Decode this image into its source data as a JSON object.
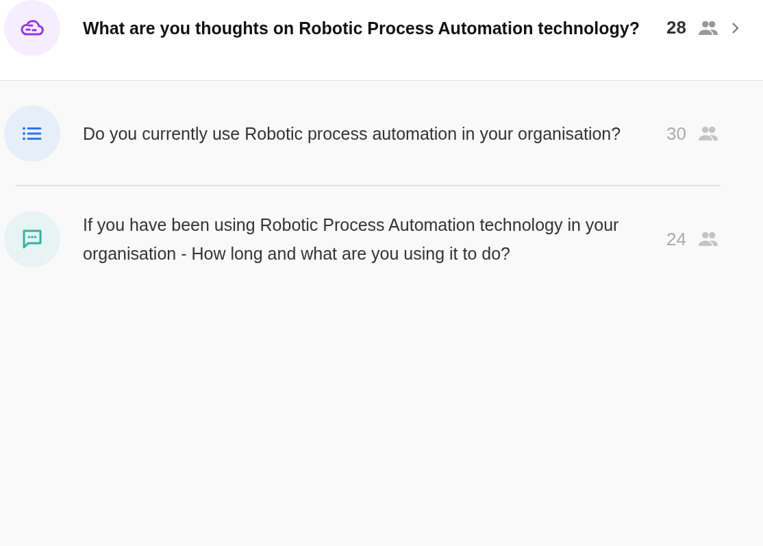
{
  "questions": [
    {
      "kind": "cloud",
      "question": "What are you thoughts on Robotic Process Automation technology?",
      "count": "28",
      "selected": true
    },
    {
      "kind": "list",
      "question": "Do you currently use Robotic process automation in your organisation?",
      "count": "30",
      "selected": false
    },
    {
      "kind": "chat",
      "question": "If you have been using Robotic Process Automation technology in your organisation - How long and what are you using it to do?",
      "count": "24",
      "selected": false
    }
  ]
}
